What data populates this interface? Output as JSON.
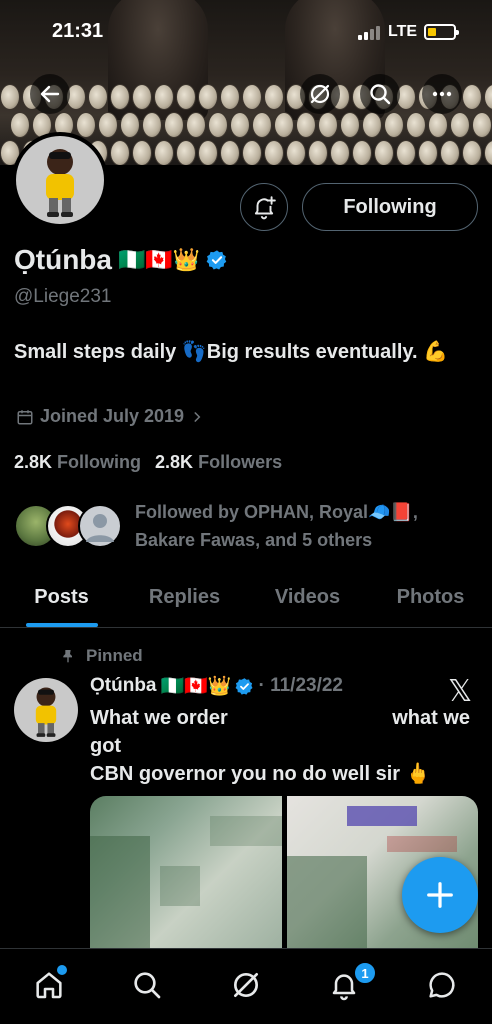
{
  "status_bar": {
    "time": "21:31",
    "network": "LTE"
  },
  "profile": {
    "name": "Ọtúnba",
    "flags": "🇳🇬🇨🇦👑",
    "handle": "@Liege231",
    "bio": "Small steps daily 👣Big results eventually. 💪",
    "joined": "Joined July 2019",
    "following_count": "2.8K",
    "following_label": "Following",
    "followers_count": "2.8K",
    "followers_label": "Followers",
    "followed_by": "Followed by OPHAN, Royal🧢📕, Bakare Fawas, and 5 others",
    "follow_button": "Following"
  },
  "tabs": [
    {
      "label": "Posts",
      "active": true
    },
    {
      "label": "Replies",
      "active": false
    },
    {
      "label": "Videos",
      "active": false
    },
    {
      "label": "Photos",
      "active": false
    }
  ],
  "post": {
    "pinned_label": "Pinned",
    "author": "Ọtúnba",
    "author_flags": "🇳🇬🇨🇦👑",
    "date": "· 11/23/22",
    "line1_left": "What we order",
    "line1_right": "what we",
    "line2": "got",
    "line3": "CBN governor you no do well sir 🖕"
  },
  "nav": {
    "items": [
      "home-icon",
      "search-icon",
      "grok-icon",
      "notifications-icon",
      "messages-icon"
    ],
    "notifications_badge": "1"
  },
  "colors": {
    "accent": "#1d9bf0",
    "muted": "#71767b",
    "text": "#e7e9ea",
    "background": "#000000"
  }
}
